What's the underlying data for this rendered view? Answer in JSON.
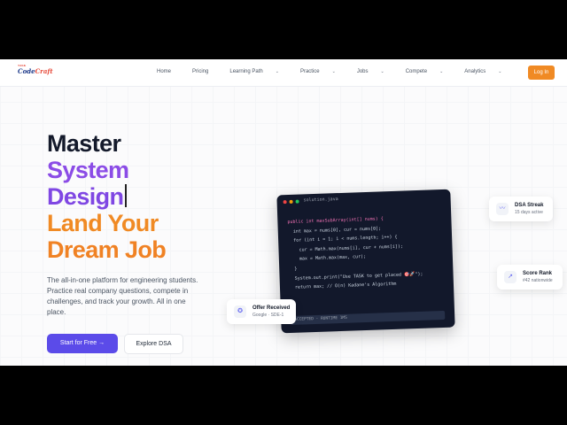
{
  "logo": {
    "tagline": "TASK",
    "code": "Code",
    "craft": "Craft"
  },
  "nav": {
    "items": [
      {
        "label": "Home",
        "dropdown": false
      },
      {
        "label": "Pricing",
        "dropdown": false
      },
      {
        "label": "Learning Path",
        "dropdown": true
      },
      {
        "label": "Practice",
        "dropdown": true
      },
      {
        "label": "Jobs",
        "dropdown": true
      },
      {
        "label": "Compete",
        "dropdown": true
      },
      {
        "label": "Analytics",
        "dropdown": true
      }
    ],
    "active": "Home",
    "login_label": "Log In"
  },
  "hero": {
    "lines": [
      "Master",
      "System",
      "Design",
      "Land Your",
      "Dream Job"
    ],
    "description": "The all-in-one platform for engineering students. Practice real company questions, compete in challenges, and track your growth. All in one place.",
    "primary_cta": "Start for Free",
    "primary_cta_icon": "→",
    "secondary_cta": "Explore DSA"
  },
  "code_card": {
    "filename": "solution.java",
    "lines": [
      "public int maxSubArray(int[] nums) {",
      "  int max = nums[0], cur = nums[0];",
      "",
      "  for (int i = 1; i < nums.length; i++) {",
      "    cur = Math.max(nums[i], cur + nums[i]);",
      "    max = Math.max(max, cur);",
      "  }",
      "  System.out.print(\"Use TASK to get placed 🎯🚀\");",
      "  return max; // O(n) Kadane's Algorithm"
    ],
    "result": "ACCEPTED · RUNTIME 1MS",
    "dot_colors": [
      "#ef4444",
      "#f59e0b",
      "#22c55e"
    ]
  },
  "badges": {
    "streak": {
      "title": "DSA Streak",
      "subtitle": "15 days active",
      "icon": "pulse-icon"
    },
    "rank": {
      "title": "Score Rank",
      "subtitle": "#42 nationwide",
      "icon": "trend-up-icon"
    },
    "offer": {
      "title": "Offer Received",
      "subtitle": "Google · SDE-1",
      "icon": "award-icon"
    }
  },
  "colors": {
    "accent_orange": "#f08a24",
    "accent_purple": "#8b4ce6",
    "primary_button": "#5b4be9"
  }
}
